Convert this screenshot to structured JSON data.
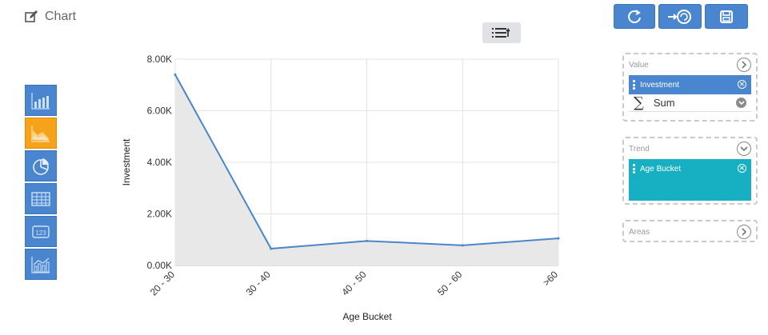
{
  "header": {
    "title": "Chart",
    "icon": "edit-icon"
  },
  "toolbar": {
    "buttons": [
      {
        "name": "refresh-button",
        "icon": "refresh-icon"
      },
      {
        "name": "export-button",
        "icon": "export-icon"
      },
      {
        "name": "save-button",
        "icon": "save-icon"
      }
    ],
    "accent": "#4a86d0"
  },
  "sort_button": {
    "icon": "sort-list-icon"
  },
  "chart_types": [
    {
      "name": "bar-chart",
      "icon": "bar-chart-icon",
      "active": false
    },
    {
      "name": "area-chart",
      "icon": "area-chart-icon",
      "active": true
    },
    {
      "name": "pie-chart",
      "icon": "pie-chart-icon",
      "active": false
    },
    {
      "name": "table",
      "icon": "table-icon",
      "active": false
    },
    {
      "name": "number",
      "icon": "number-icon",
      "active": false
    },
    {
      "name": "combo-chart",
      "icon": "combo-chart-icon",
      "active": false
    }
  ],
  "panels": {
    "value": {
      "label": "Value",
      "field": "Investment",
      "aggregation": "Sum"
    },
    "trend": {
      "label": "Trend",
      "field": "Age Bucket"
    },
    "areas": {
      "label": "Areas"
    }
  },
  "chart_data": {
    "type": "area",
    "categories": [
      "20 - 30",
      "30 - 40",
      "40 - 50",
      "50 - 60",
      ">60"
    ],
    "series": [
      {
        "values": [
          7400,
          650,
          950,
          780,
          1050
        ]
      }
    ],
    "xlabel": "Age Bucket",
    "ylabel": "Investment",
    "ylim": [
      0,
      8000
    ],
    "yticks": [
      "0.00K",
      "2.00K",
      "4.00K",
      "6.00K",
      "8.00K"
    ],
    "grid": true,
    "line_color": "#4a86c8",
    "fill_color": "#e8e8e8"
  }
}
